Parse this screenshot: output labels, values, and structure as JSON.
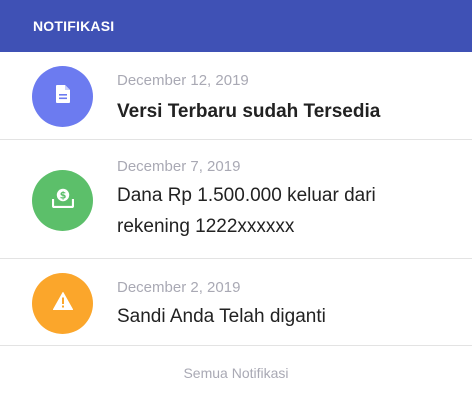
{
  "header": {
    "title": "NOTIFIKASI"
  },
  "notifications": [
    {
      "date": "December 12, 2019",
      "title": "Versi Terbaru sudah Tersedia",
      "icon": "document-icon",
      "color": "#6c7bf0"
    },
    {
      "date": "December 7, 2019",
      "title": "Dana Rp 1.500.000 keluar dari rekening 1222xxxxxx",
      "icon": "money-icon",
      "color": "#5cbf6a"
    },
    {
      "date": "December 2, 2019",
      "title": "Sandi Anda Telah diganti",
      "icon": "warning-icon",
      "color": "#fba62b"
    }
  ],
  "footer": {
    "link_label": "Semua Notifikasi"
  },
  "colors": {
    "header_bg": "#3f51b5"
  }
}
